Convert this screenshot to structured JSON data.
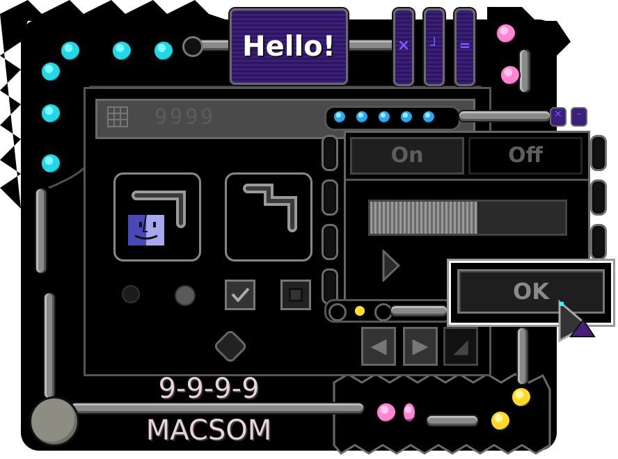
{
  "header": {
    "hello_label": "Hello!"
  },
  "window": {
    "counter_display": "9999",
    "footer_numbers": "9-9-9-9",
    "footer_brand": "MACSOM"
  },
  "panel": {
    "tabs": [
      "On",
      "Off"
    ],
    "ok_label": "OK",
    "progress_fraction": 0.55
  },
  "icons": {
    "grid": "grid-icon",
    "finder": "finder-face-icon",
    "play": "play-icon",
    "prev": "prev-arrow-icon",
    "next": "next-arrow-icon",
    "resize": "resize-icon",
    "cursor": "cursor-arrow-icon"
  },
  "colors": {
    "frame": "#000000",
    "metal": "#8a8a8a",
    "cyan_led": "#22d8e6",
    "pink_led": "#ff85d2",
    "yellow_led": "#ffd82a",
    "hello_bg": "#3c1f7a",
    "finder_blue": "#6b6bd8"
  }
}
